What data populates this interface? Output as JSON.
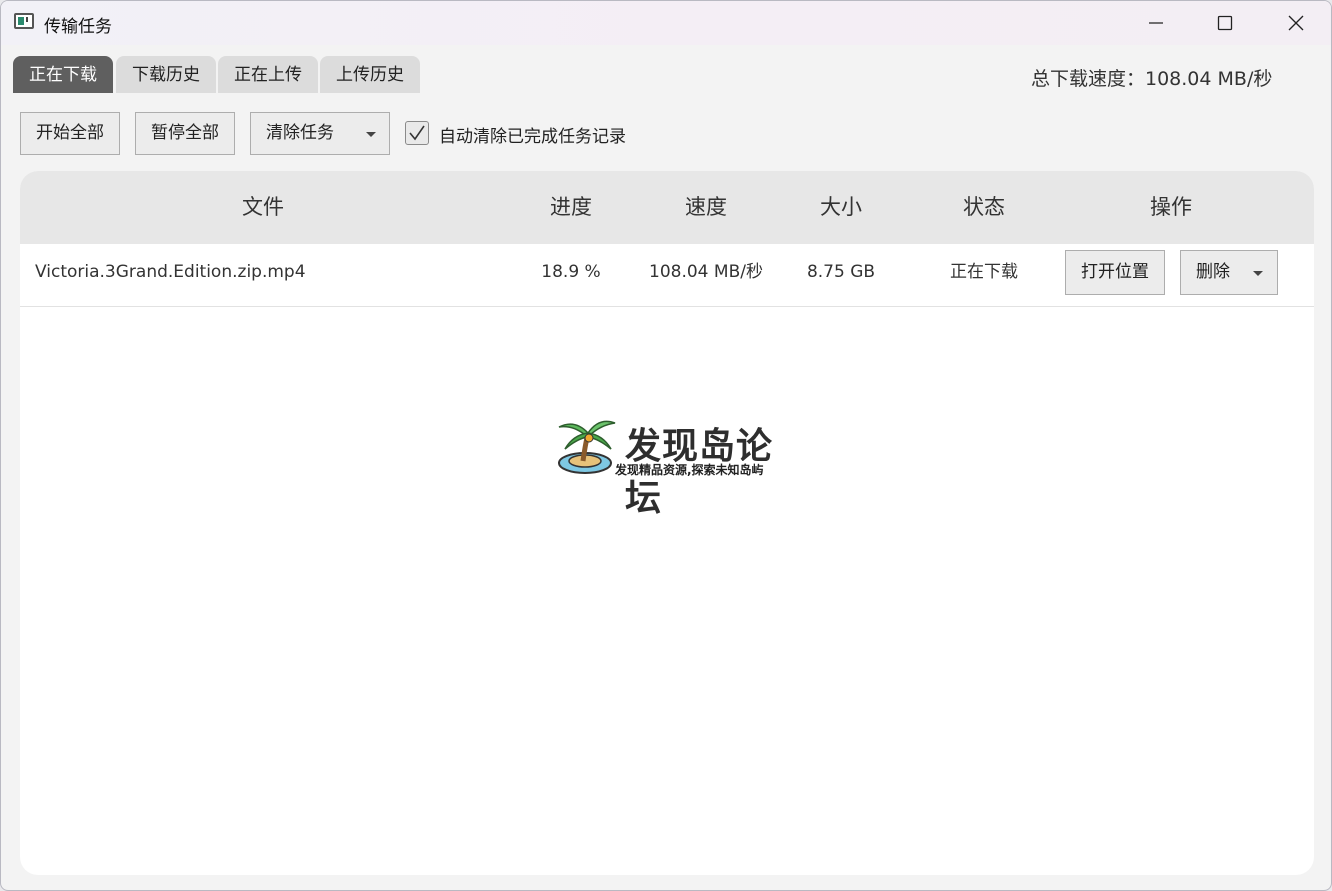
{
  "window": {
    "title": "传输任务"
  },
  "tabs": [
    {
      "label": "正在下载",
      "active": true
    },
    {
      "label": "下载历史",
      "active": false
    },
    {
      "label": "正在上传",
      "active": false
    },
    {
      "label": "上传历史",
      "active": false
    }
  ],
  "speed": {
    "text": "总下载速度：108.04 MB/秒"
  },
  "toolbar": {
    "start_all": "开始全部",
    "pause_all": "暂停全部",
    "clear_tasks": "清除任务",
    "auto_clear_label": "自动清除已完成任务记录",
    "auto_clear_checked": true
  },
  "table": {
    "columns": [
      "文件",
      "进度",
      "速度",
      "大小",
      "状态",
      "操作"
    ],
    "rows": [
      {
        "file": "Victoria.3Grand.Edition.zip.mp4",
        "progress": "18.9 %",
        "speed": "108.04 MB/秒",
        "size": "8.75 GB",
        "status": "正在下载",
        "open_location": "打开位置",
        "delete": "删除"
      }
    ]
  },
  "watermark": {
    "title": "发现岛论坛",
    "subtitle": "发现精品资源,探索未知岛屿"
  },
  "colors": {
    "active_tab": "#5f5f5f",
    "tab": "#dcdcdc",
    "header_bg": "#e7e7e7"
  }
}
